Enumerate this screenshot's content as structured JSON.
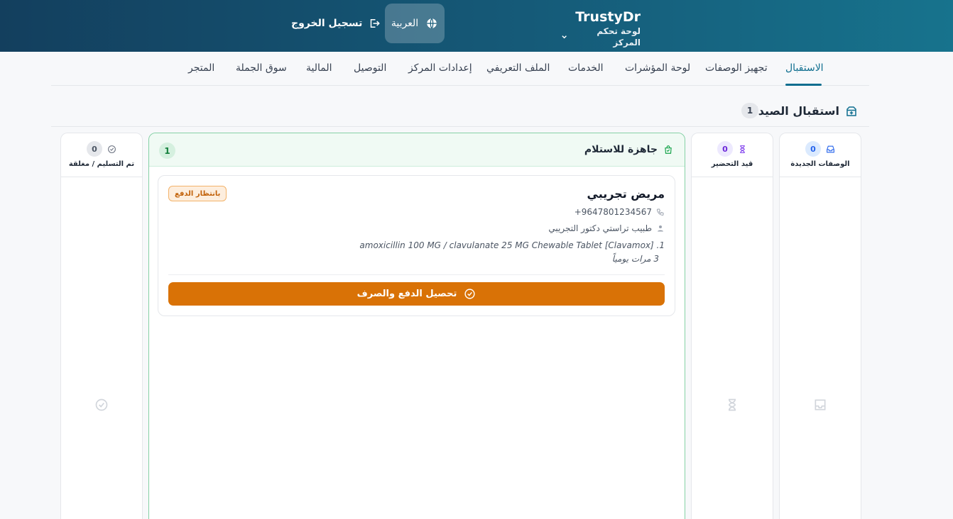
{
  "header": {
    "brand_name": "TrustyDr",
    "brand_sub": "لوحة تحكم المركز",
    "language": "العربية",
    "logout": "تسجيل الخروج"
  },
  "tabs": [
    {
      "label": "الاستقبال",
      "active": true
    },
    {
      "label": "تجهيز الوصفات"
    },
    {
      "label": "لوحة المؤشرات"
    },
    {
      "label": "الخدمات"
    },
    {
      "label": "الملف التعريفي"
    },
    {
      "label": "إعدادات المركز"
    },
    {
      "label": "التوصيل"
    },
    {
      "label": "المالية"
    },
    {
      "label": "سوق الجملة"
    },
    {
      "label": "المتجر"
    }
  ],
  "section": {
    "title": "استقبال الصيدلية",
    "count": "1"
  },
  "columns": {
    "new": {
      "label": "الوصفات الجديدة",
      "count": "0",
      "color": "#2563eb"
    },
    "preparing": {
      "label": "قيد التحضير",
      "count": "0",
      "color": "#7c3aed"
    },
    "ready": {
      "label": "جاهزة للاستلام",
      "count": "1",
      "color": "#16a34a"
    },
    "delivered": {
      "label": "تم التسليم / مغلقة",
      "count": "0",
      "color": "#6b7280"
    }
  },
  "card": {
    "patient": "مريض تجريبي",
    "status": "بانتظار الدفع",
    "phone": "+9647801234567",
    "doctor": "طبيب تراستي دكتور التجريبي",
    "medication": "1. amoxicillin 100 MG / clavulanate 25 MG Chewable Tablet [Clavamox]",
    "dosage": "3 مرات يومياً",
    "action": "تحصيل الدفع والصرف"
  },
  "colors": {
    "brand_dark": "#133f5e",
    "accent": "#0f6e8f",
    "action": "#d97206"
  }
}
